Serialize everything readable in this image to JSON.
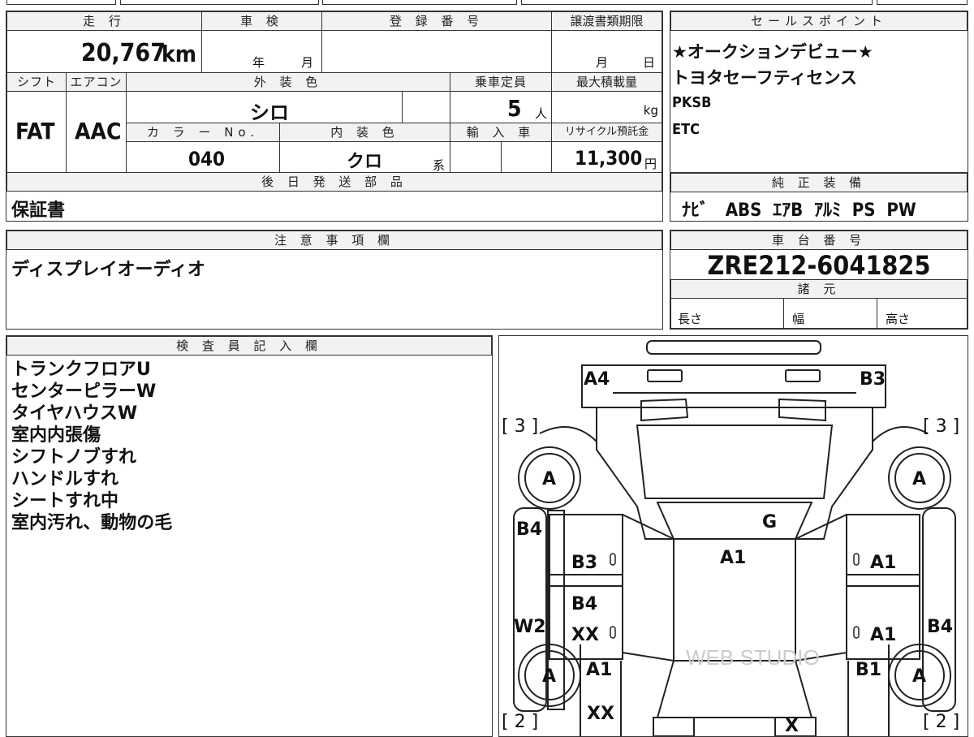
{
  "top_strip": {
    "fragment1": "",
    "fragment2": ""
  },
  "left_top": {
    "mileage_label": "走 行",
    "mileage": "20,767",
    "mileage_unit": "km",
    "inspection_label": "車 検",
    "inspection_year": "年",
    "inspection_month": "月",
    "reg_label": "登 録 番 号",
    "transfer_label": "譲渡書類期限",
    "transfer_month": "月",
    "transfer_day": "日",
    "shift_label": "シフト",
    "ac_label": "エアコン",
    "shift_value": "FAT",
    "ac_value": "AAC",
    "ext_color_label": "外 装 色",
    "ext_color_value": "シロ",
    "capacity_label": "乗車定員",
    "capacity_value": "5",
    "capacity_unit": "人",
    "max_load_label": "最大積載量",
    "max_load_unit": "kg",
    "color_no_label": "カ ラ ー No.",
    "color_no_value": "040",
    "int_color_label": "内 装 色",
    "int_color_value": "クロ",
    "int_color_suffix": "系",
    "import_label": "輸 入 車",
    "recycle_label": "リサイクル預託金",
    "recycle_value": "11,300",
    "recycle_unit": "円",
    "later_parts_label": "後 日 発 送 部 品",
    "later_parts_value": "保証書",
    "notes_label": "注 意 事 項 欄",
    "notes_value": "ディスプレイオーディオ"
  },
  "right_top": {
    "sales_label": "セールスポイント",
    "sales_points": [
      "★オークションデビュー★",
      "トヨタセーフティセンス",
      "PKSB",
      "ETC"
    ],
    "equipment_label": "純 正 装 備",
    "equipment": [
      "ﾅﾋﾞ",
      "ABS",
      "ｴｱB",
      "ｱﾙﾐ",
      "PS",
      "PW"
    ],
    "chassis_label": "車 台 番 号",
    "chassis_value": "ZRE212-6041825",
    "spec_label": "諸 元",
    "length_label": "長さ",
    "width_label": "幅",
    "height_label": "高さ"
  },
  "inspector": {
    "label": "検 査 員 記 入 欄",
    "items": [
      "トランクフロアU",
      "センターピラーW",
      "タイヤハウスW",
      "室内内張傷",
      "シフトノブすれ",
      "ハンドルすれ",
      "シートすれ中",
      "室内汚れ、動物の毛"
    ]
  },
  "diagram": {
    "labels": {
      "a4": "A4",
      "b3_top": "B3",
      "tire_fl": "A",
      "tire_fr": "A",
      "tire_rl": "A",
      "tire_rr": "A",
      "bracket_tl": "[ 3 ]",
      "bracket_tr": "[ 3 ]",
      "bracket_bl": "[ 2 ]",
      "bracket_br": "[ 2 ]",
      "g": "G",
      "a1_roof": "A1",
      "b4_left": "B4",
      "b3_door": "B3",
      "zero1": "0",
      "zero2": "0",
      "a1_rdoor": "A1",
      "b4_door": "B4",
      "xx_door": "XX",
      "zero3": "0",
      "zero4": "0",
      "a1_rdoor2": "A1",
      "w2": "W2",
      "b4_right": "B4",
      "a1_lq": "A1",
      "b1_rq": "B1",
      "xx_bottom": "XX",
      "x_bottom": "X",
      "watermark": "WEB STUDIO"
    }
  }
}
